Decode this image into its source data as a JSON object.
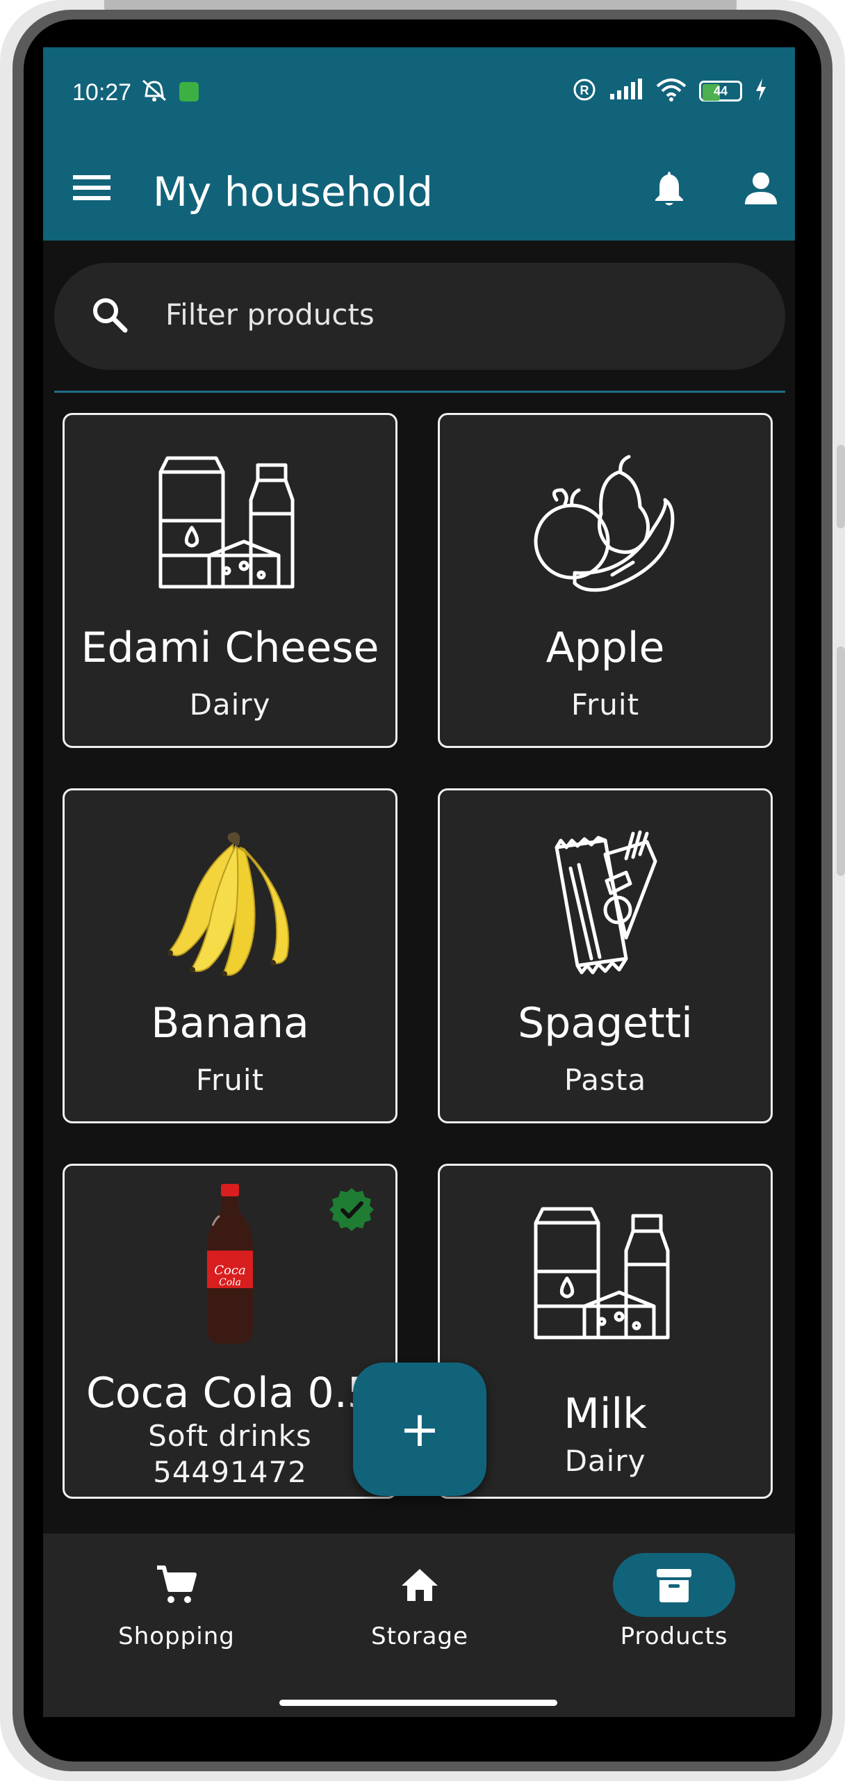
{
  "status_bar": {
    "time": "10:27",
    "battery_level": "44",
    "icons": [
      "mute-icon",
      "app-notification-icon",
      "registered-icon",
      "signal-icon",
      "wifi-icon",
      "battery-icon",
      "charging-icon"
    ]
  },
  "app_bar": {
    "title": "My household",
    "menu_icon": "hamburger-menu-icon",
    "notification_icon": "bell-icon",
    "profile_icon": "person-icon"
  },
  "search": {
    "placeholder": "Filter products"
  },
  "products": [
    {
      "name": "Edami Cheese",
      "category": "Dairy",
      "icon": "dairy-products-icon"
    },
    {
      "name": "Apple",
      "category": "Fruit",
      "icon": "fruit-icon"
    },
    {
      "name": "Banana",
      "category": "Fruit",
      "icon": "banana-photo"
    },
    {
      "name": "Spagetti",
      "category": "Pasta",
      "icon": "pasta-package-icon"
    },
    {
      "name": "Coca Cola 0.5",
      "category": "Soft drinks",
      "barcode": "54491472",
      "icon": "cola-bottle-photo",
      "verified": true
    },
    {
      "name": "Milk",
      "category": "Dairy",
      "icon": "dairy-products-icon"
    }
  ],
  "fab": {
    "label": "+",
    "icon": "add-icon"
  },
  "bottom_nav": {
    "items": [
      {
        "label": "Shopping",
        "icon": "cart-icon",
        "active": false
      },
      {
        "label": "Storage",
        "icon": "home-icon",
        "active": false
      },
      {
        "label": "Products",
        "icon": "archive-box-icon",
        "active": true
      }
    ]
  },
  "colors": {
    "primary": "#11637a",
    "background": "#121212",
    "surface": "#252525",
    "verified_green": "#1e7d32"
  }
}
